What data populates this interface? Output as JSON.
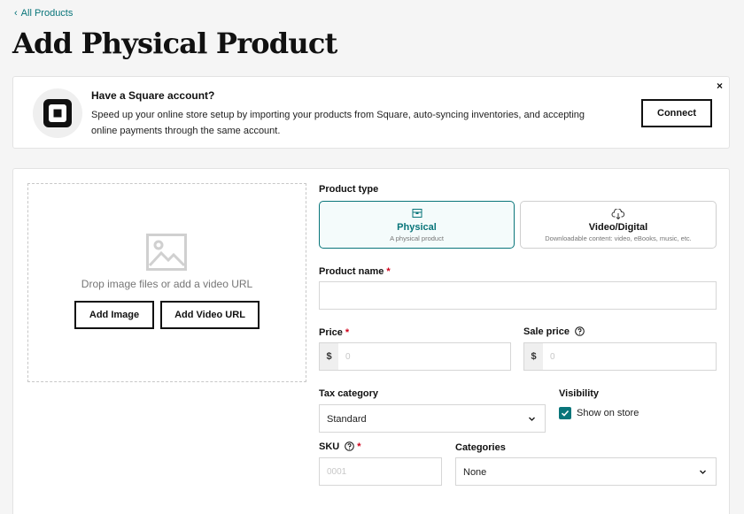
{
  "nav": {
    "back_label": "All Products"
  },
  "page": {
    "title": "Add Physical Product"
  },
  "banner": {
    "title": "Have a Square account?",
    "text": "Speed up your online store setup by importing your products from Square, auto-syncing inventories, and accepting online payments through the same account.",
    "connect_label": "Connect",
    "close_label": "×"
  },
  "media": {
    "drop_text": "Drop image files or add a video URL",
    "add_image_label": "Add Image",
    "add_video_label": "Add Video URL"
  },
  "form": {
    "product_type": {
      "label": "Product type",
      "options": [
        {
          "name": "Physical",
          "desc": "A physical product",
          "selected": true
        },
        {
          "name": "Video/Digital",
          "desc": "Downloadable content: video, eBooks, music, etc.",
          "selected": false
        }
      ]
    },
    "product_name": {
      "label": "Product name",
      "required_mark": "*",
      "value": ""
    },
    "price": {
      "label": "Price",
      "required_mark": "*",
      "currency": "$",
      "placeholder": "0"
    },
    "sale_price": {
      "label": "Sale price",
      "currency": "$",
      "placeholder": "0"
    },
    "tax_category": {
      "label": "Tax category",
      "value": "Standard"
    },
    "visibility": {
      "label": "Visibility",
      "checkbox_label": "Show on store",
      "checked": true
    },
    "sku": {
      "label": "SKU",
      "required_mark": "*",
      "placeholder": "0001"
    },
    "categories": {
      "label": "Categories",
      "value": "None"
    }
  },
  "colors": {
    "accent": "#09757a",
    "required": "#d0021b"
  }
}
